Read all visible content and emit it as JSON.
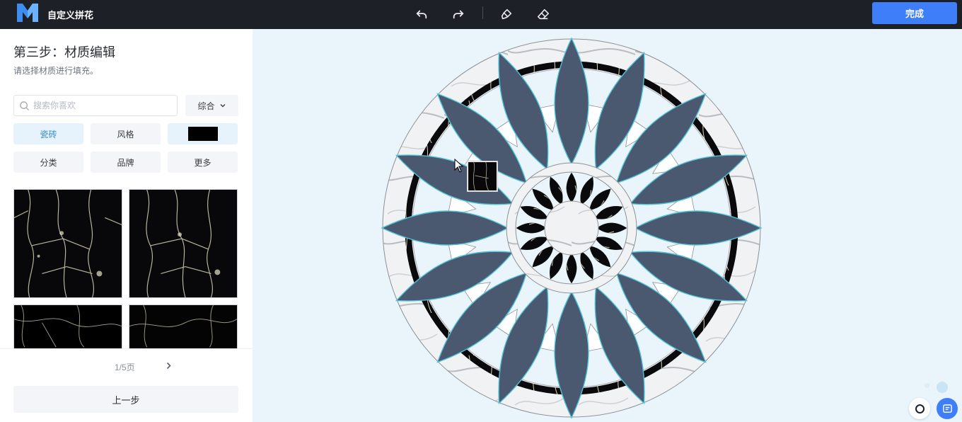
{
  "header": {
    "app_title": "自定义拼花",
    "done_label": "完成"
  },
  "panel": {
    "step_title": "第三步：材质编辑",
    "step_subtitle": "请选择材质进行填充。",
    "search": {
      "placeholder": "搜索你喜欢"
    },
    "sort": {
      "selected": "综合"
    },
    "filters": {
      "tile": "瓷砖",
      "style": "风格",
      "category": "分类",
      "brand": "品牌",
      "more": "更多"
    },
    "color_swatch": "#000000",
    "pagination": {
      "text": "1/5页"
    },
    "prev_step_label": "上一步"
  },
  "colors": {
    "accent": "#3e7ef8",
    "topbar": "#1d2026",
    "petal_fill": "#4a5870",
    "petal_stroke": "#4fc2d8",
    "active_filter_text": "#3c8fd8"
  },
  "icons": {
    "undo": "undo-icon",
    "redo": "redo-icon",
    "brush": "brush-icon",
    "eraser": "eraser-icon",
    "search": "search-icon",
    "chevron_down": "chevron-down-icon",
    "chevron_right": "chevron-right-icon",
    "cursor": "mouse-cursor-icon",
    "chat": "chat-icon"
  }
}
